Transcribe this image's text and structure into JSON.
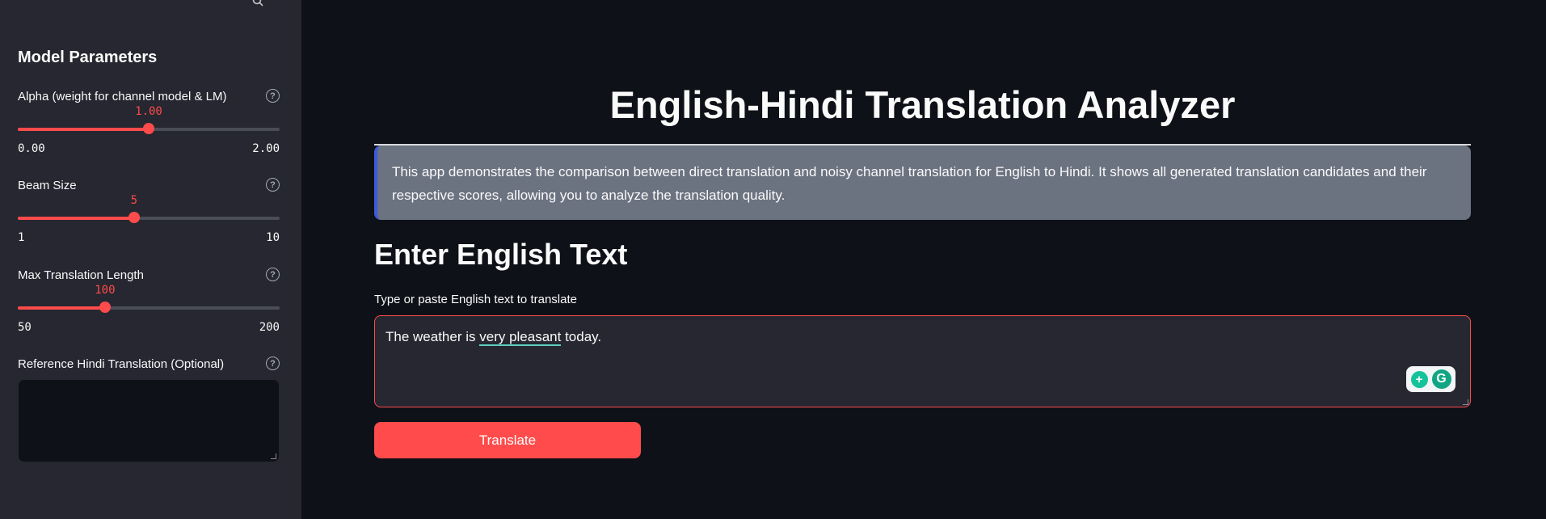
{
  "sidebar": {
    "heading": "Model Parameters",
    "alpha": {
      "label": "Alpha (weight for channel model & LM)",
      "value": "1.00",
      "min": "0.00",
      "max": "2.00",
      "level": 0.5
    },
    "beam": {
      "label": "Beam Size",
      "value": "5",
      "min": "1",
      "max": "10",
      "level": 0.444
    },
    "max_len": {
      "label": "Max Translation Length",
      "value": "100",
      "min": "50",
      "max": "200",
      "level": 0.333
    },
    "reference": {
      "label": "Reference Hindi Translation (Optional)",
      "value": ""
    }
  },
  "main": {
    "title": "English-Hindi Translation Analyzer",
    "info": "This app demonstrates the comparison between direct translation and noisy channel translation for English to Hindi. It shows all generated translation candidates and their respective scores, allowing you to analyze the translation quality.",
    "section_heading": "Enter English Text",
    "input_label": "Type or paste English text to translate",
    "input_text_before": "The weather is ",
    "input_text_flagged": "very pleasant",
    "input_text_after": " today.",
    "translate_label": "Translate"
  },
  "icons": {
    "help": "help-circle-icon",
    "grammarly_bulb": "grammarly-suggestion-icon",
    "grammarly_logo": "grammarly-logo-icon"
  },
  "colors": {
    "accent": "#ff4b4b",
    "background": "#0e1117",
    "sidebar": "#262730",
    "info_box": "#6b7280",
    "info_border": "#3b5bdb",
    "grammarly": "#15c39a"
  }
}
